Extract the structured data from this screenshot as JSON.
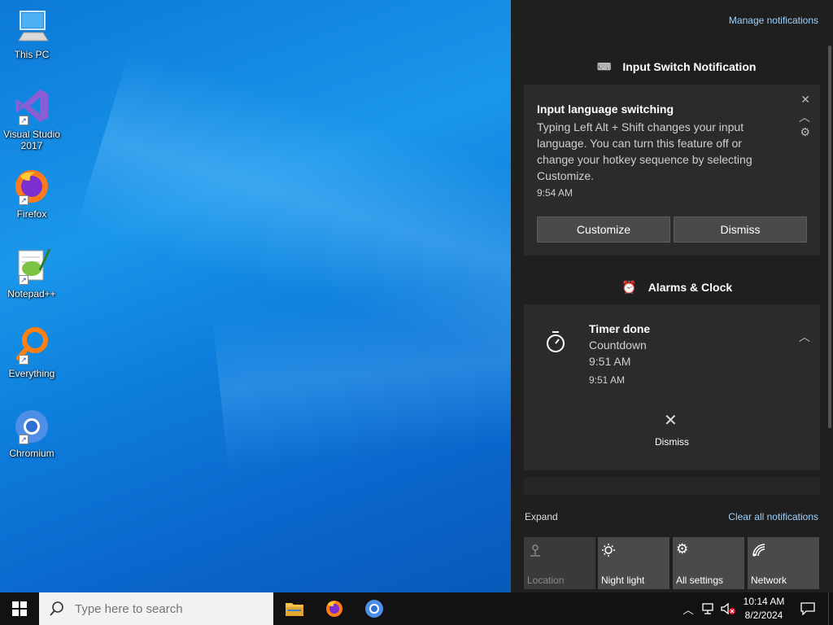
{
  "desktop": {
    "icons": [
      {
        "label": "This PC"
      },
      {
        "label": "Visual Studio 2017"
      },
      {
        "label": "Firefox"
      },
      {
        "label": "Notepad++"
      },
      {
        "label": "Everything"
      },
      {
        "label": "Chromium"
      }
    ]
  },
  "action_center": {
    "manage_link": "Manage notifications",
    "groups": [
      {
        "title": "Input Switch Notification",
        "notification": {
          "title": "Input language switching",
          "body": "Typing Left Alt + Shift changes your input language. You can turn this feature off or change your hotkey sequence by selecting Customize.",
          "time": "9:54 AM",
          "buttons": [
            "Customize",
            "Dismiss"
          ]
        }
      },
      {
        "title": "Alarms & Clock",
        "notification": {
          "title": "Timer done",
          "line1": "Countdown",
          "line2": "9:51 AM",
          "time": "9:51 AM",
          "dismiss_label": "Dismiss"
        }
      }
    ],
    "expand_link": "Expand",
    "clear_link": "Clear all notifications",
    "quick_actions": [
      {
        "label": "Location",
        "icon": "location-icon",
        "state": "off"
      },
      {
        "label": "Night light",
        "icon": "night-light-icon",
        "state": "on"
      },
      {
        "label": "All settings",
        "icon": "settings-icon",
        "state": "on"
      },
      {
        "label": "Network",
        "icon": "network-icon",
        "state": "on"
      }
    ]
  },
  "taskbar": {
    "search_placeholder": "Type here to search",
    "apps": [
      "file-explorer-icon",
      "firefox-icon",
      "chromium-icon"
    ],
    "clock": {
      "time": "10:14 AM",
      "date": "8/2/2024"
    }
  },
  "colors": {
    "link": "#9fd2ff",
    "panel": "#1f1f1f",
    "card": "#2b2b2b",
    "desktop": "#0a6fd6"
  }
}
